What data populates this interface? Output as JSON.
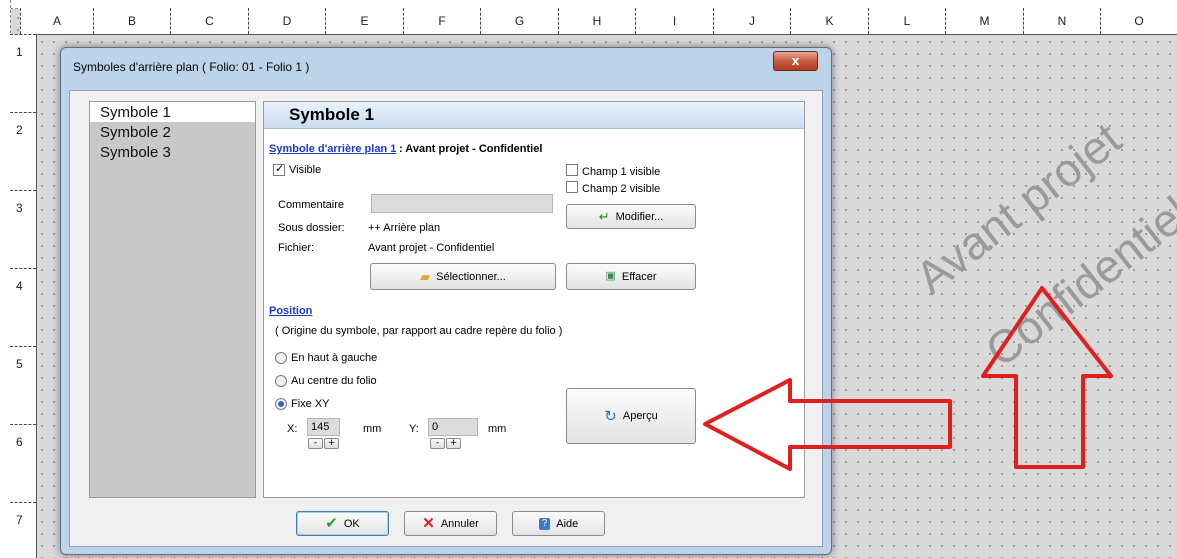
{
  "sheet": {
    "columns": [
      "A",
      "B",
      "C",
      "D",
      "E",
      "F",
      "G",
      "H",
      "I",
      "J",
      "K",
      "L",
      "M",
      "N",
      "O"
    ],
    "rows": [
      "1",
      "2",
      "3",
      "4",
      "5",
      "6",
      "7"
    ],
    "watermark_line1": "Avant projet",
    "watermark_line2": "Confidentiel"
  },
  "dialog": {
    "title": "Symboles d'arrière plan ( Folio: 01 - Folio 1 )",
    "close_label": "x",
    "symbols": [
      "Symbole 1",
      "Symbole 2",
      "Symbole 3"
    ],
    "panel_title": "Symbole 1",
    "symbol_link": "Symbole d'arrière plan 1",
    "symbol_name": ": Avant projet - Confidentiel",
    "visible_label": "Visible",
    "visible_checked": true,
    "champ1_label": "Champ 1 visible",
    "champ2_label": "Champ 2 visible",
    "commentaire_label": "Commentaire",
    "commentaire_value": "",
    "modifier_label": "Modifier...",
    "sous_dossier_label": "Sous dossier:",
    "sous_dossier_value": "++ Arrière plan",
    "fichier_label": "Fichier:",
    "fichier_value": "Avant projet - Confidentiel",
    "selectionner_label": "Sélectionner...",
    "effacer_label": "Effacer",
    "position_link": "Position",
    "position_hint": "( Origine du symbole, par rapport au cadre repère du folio )",
    "radio_options": [
      "En haut à gauche",
      "Au centre du folio",
      "Fixe XY"
    ],
    "radio_selected": "Fixe XY",
    "x_label": "X:",
    "x_value": "145",
    "y_label": "Y:",
    "y_value": "0",
    "unit": "mm",
    "spin_minus": "-",
    "spin_plus": "+",
    "apercu_label": "Aperçu",
    "ok_label": "OK",
    "annuler_label": "Annuler",
    "aide_label": "Aide"
  },
  "colors": {
    "link": "#1a3cc4",
    "annotation_arrow": "#e0201f",
    "dialog_frame": "#bcd3ea"
  }
}
